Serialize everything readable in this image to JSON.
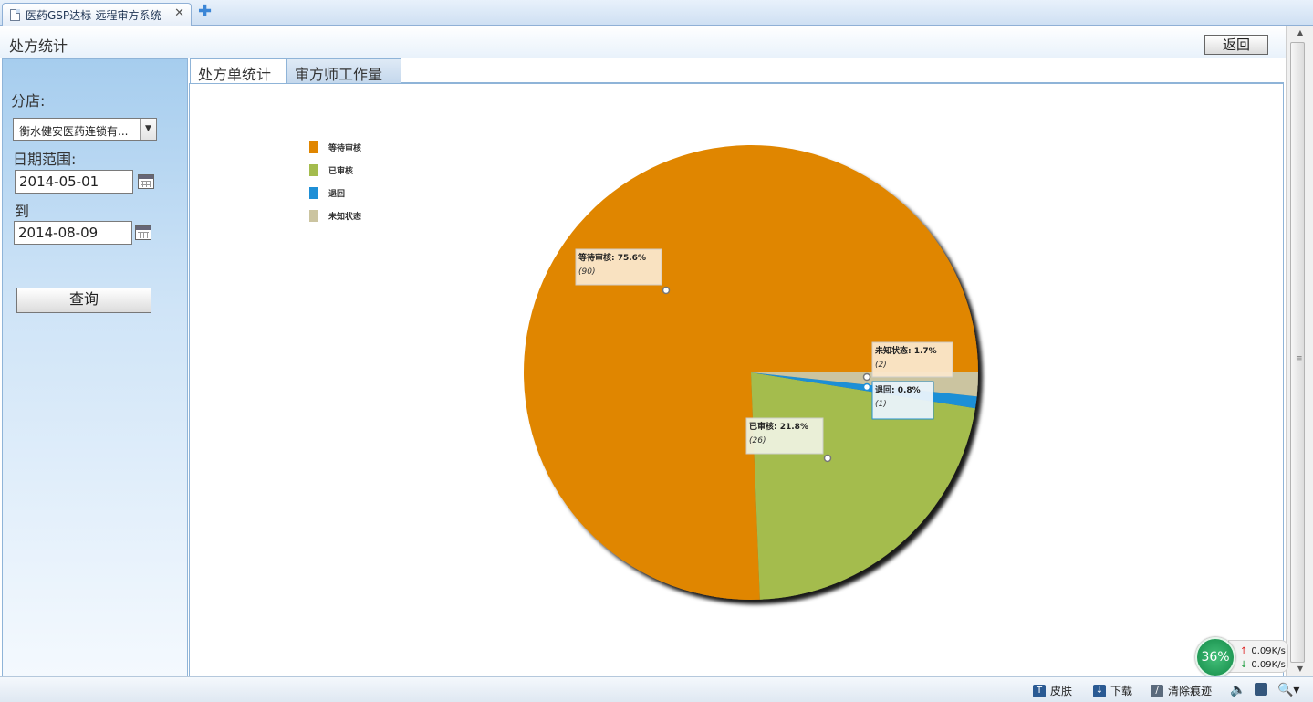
{
  "browser": {
    "tab_title": "医药GSP达标-远程审方系统",
    "close_glyph": "✕",
    "new_tab_glyph": "✚"
  },
  "page": {
    "title": "处方统计",
    "back_label": "返回"
  },
  "filters": {
    "branch_label": "分店:",
    "branch_value": "衡水健安医药连锁有...",
    "date_range_label": "日期范围:",
    "date_from": "2014-05-01",
    "to_label": "到",
    "date_to": "2014-08-09",
    "query_label": "查询"
  },
  "tabs": [
    {
      "label": "处方单统计",
      "active": true
    },
    {
      "label": "审方师工作量",
      "active": false
    }
  ],
  "chart_data": {
    "type": "pie",
    "title": "",
    "legend_position": "top-left",
    "categories": [
      "等待审核",
      "已审核",
      "退回",
      "未知状态"
    ],
    "values": [
      90,
      26,
      1,
      2
    ],
    "percents": [
      "75.6%",
      "21.8%",
      "0.8%",
      "1.7%"
    ],
    "colors": [
      "#E08600",
      "#A4BC4E",
      "#1E8FD6",
      "#CBC4A0"
    ],
    "legend": [
      "等待审核",
      "已审核",
      "退回",
      "未知状态"
    ]
  },
  "statusbar": {
    "skin_label": "皮肤",
    "download_label": "下载",
    "clear_label": "清除痕迹"
  },
  "network": {
    "percent": "36%",
    "upload": "0.09K/s",
    "download": "0.09K/s"
  }
}
